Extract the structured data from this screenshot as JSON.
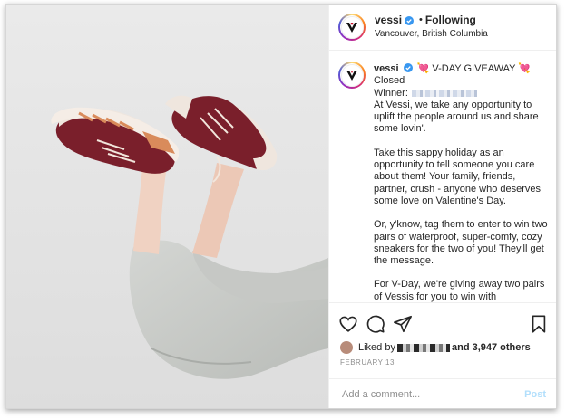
{
  "header": {
    "username": "vessi",
    "separator": "•",
    "follow_label": "Following",
    "location": "Vancouver, British Columbia"
  },
  "caption": {
    "username": "vessi",
    "title": "💘 V-DAY GIVEAWAY 💘",
    "status": "Closed",
    "winner_label": "Winner:",
    "paragraphs": [
      "At Vessi, we take any opportunity to uplift the people around us and share some lovin'.",
      "Take this sappy holiday as an opportunity to tell someone you care about them! Your family, friends, partner, crush - anyone who deserves some love on Valentine's Day.",
      "Or, y'know, tag them to enter to win two pairs of waterproof, super-comfy, cozy sneakers for the two of you! They'll get the message.",
      "For V-Day, we're giving away two pairs of Vessis for you to win with"
    ]
  },
  "actions": {
    "like_icon": "heart-icon",
    "comment_icon": "speech-bubble-icon",
    "share_icon": "paper-plane-icon",
    "save_icon": "bookmark-icon"
  },
  "likes": {
    "prefix": "Liked by",
    "suffix": "and 3,947 others"
  },
  "date": "FEBRUARY 13",
  "comment": {
    "placeholder": "Add a comment...",
    "post_label": "Post"
  },
  "colors": {
    "verified": "#3897f0",
    "post_disabled": "#b2dffc",
    "shoe_maroon": "#7a1f2b",
    "pants_gray": "#c9cbc8"
  }
}
